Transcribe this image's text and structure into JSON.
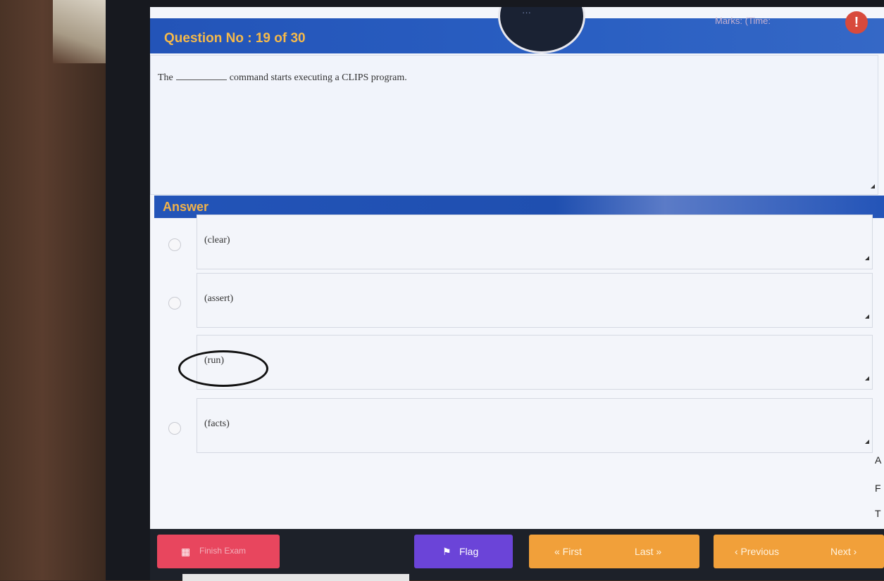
{
  "header": {
    "question_label": "Question No : 19 of 30",
    "marks_label": "Marks: (Time:",
    "timer_label": "···",
    "alert_icon": "!"
  },
  "question": {
    "text_before": "The",
    "text_after": "command starts executing a CLIPS program."
  },
  "answer": {
    "label": "Answer",
    "options": [
      {
        "label": "(clear)"
      },
      {
        "label": "(assert)"
      },
      {
        "label": "(run)"
      },
      {
        "label": "(facts)"
      }
    ]
  },
  "side_letters": [
    "A",
    "F",
    "T"
  ],
  "footer": {
    "finish_label": "Finish Exam",
    "flag_label": "Flag",
    "first_label": "« First",
    "last_label": "Last »",
    "previous_label": "‹ Previous",
    "next_label": "Next ›"
  },
  "colors": {
    "header_blue": "#2354b8",
    "accent_orange": "#f1a03a",
    "finish_red": "#e8465e",
    "flag_purple": "#6b44d8"
  }
}
